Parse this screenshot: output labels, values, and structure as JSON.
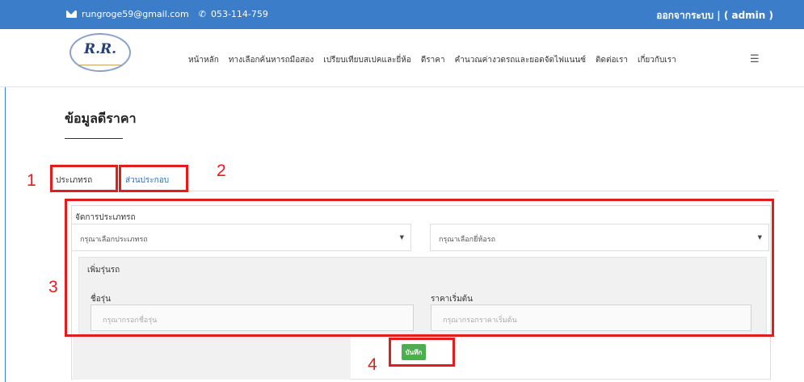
{
  "topbar": {
    "email": "rungroge59@gmail.com",
    "phone": "053-114-759",
    "logout": "ออกจากระบบ | ( admin )"
  },
  "brand": {
    "logo_text": "R.R."
  },
  "nav": {
    "items": [
      "หน้าหลัก",
      "ทางเลือกค้นหารถมือสอง",
      "เปรียบเทียบสเปคและยี่ห้อ",
      "ดีราคา",
      "คำนวณค่างวดรถและยอดจัดไฟแนนซ์",
      "ติดต่อเรา",
      "เกี่ยวกับเรา"
    ],
    "menu_icon": "hamburger-icon"
  },
  "page": {
    "title": "ข้อมูลดีราคา"
  },
  "tabs": [
    {
      "label": "ประเภทรถ"
    },
    {
      "label": "ส่วนประกอบ"
    }
  ],
  "form": {
    "section_label": "จัดการประเภทรถ",
    "select_type_placeholder": "กรุณาเลือกประเภทรถ",
    "select_brand_placeholder": "กรุณาเลือกยี่ห้อรถ",
    "add_model_title": "เพิ่มรุ่นรถ",
    "model_name_label": "ชื่อรุ่น",
    "model_name_placeholder": "กรุณากรอกชื่อรุ่น",
    "start_price_label": "ราคาเริ่มต้น",
    "start_price_placeholder": "กรุณากรอกราคาเริ่มต้น",
    "save_label": "บันทึก"
  },
  "annotations": [
    "1",
    "2",
    "3",
    "4"
  ],
  "colors": {
    "topbar": "#3b7dc8",
    "highlight": "#e51c1c",
    "save": "#4cae4c",
    "tab_link": "#2a6fc2"
  }
}
